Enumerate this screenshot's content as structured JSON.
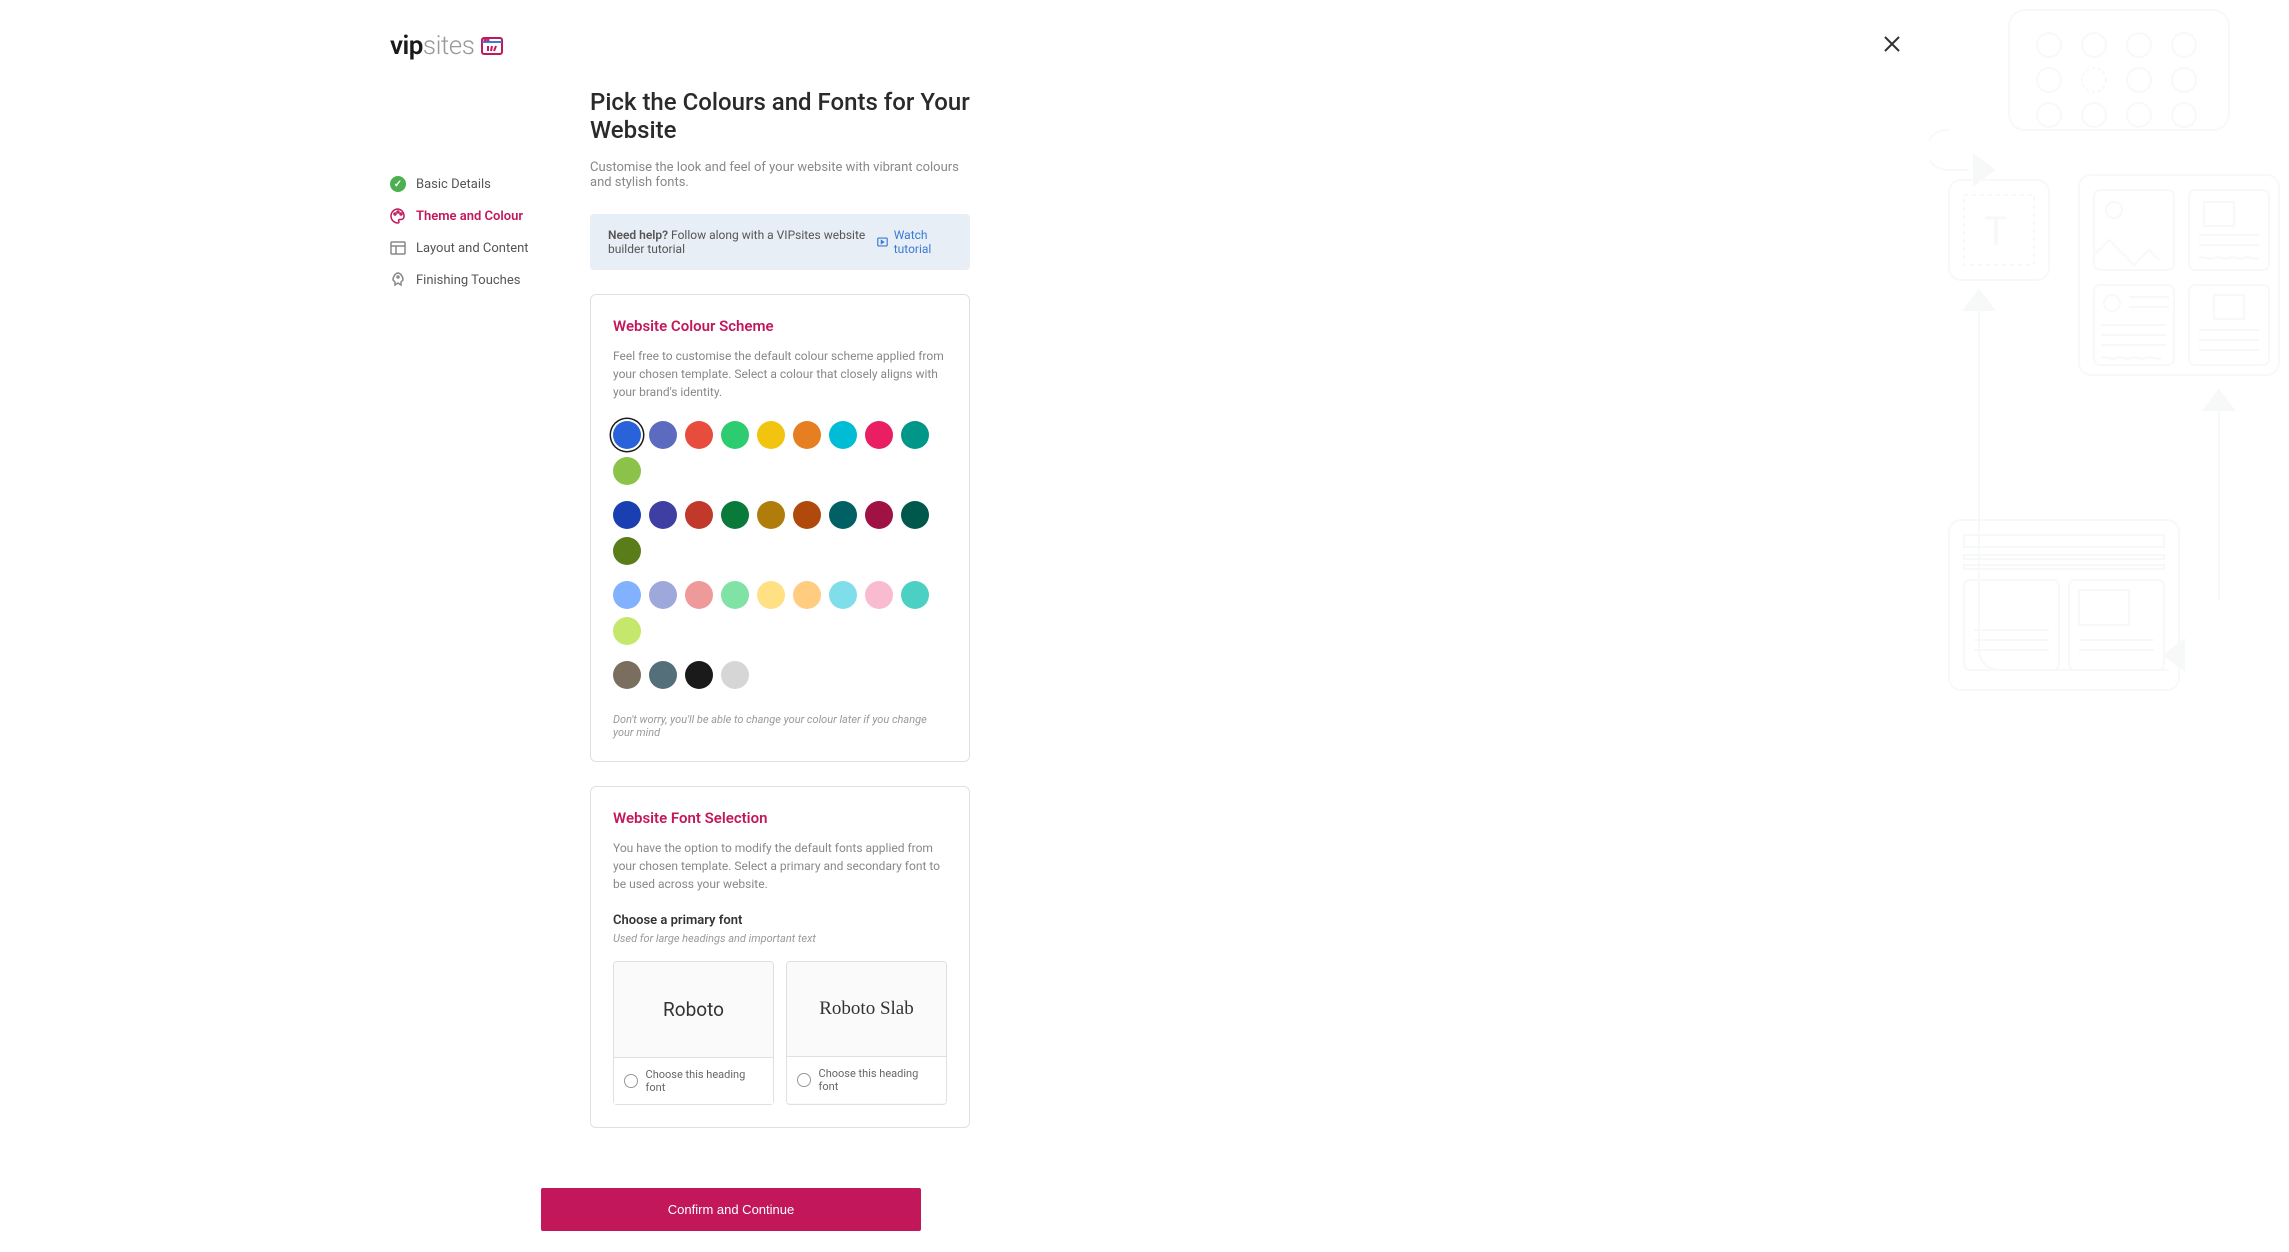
{
  "logo": {
    "text_bold": "vip",
    "text_light": "sites"
  },
  "sidebar": {
    "items": [
      {
        "label": "Basic Details",
        "status": "completed"
      },
      {
        "label": "Theme and Colour",
        "status": "active"
      },
      {
        "label": "Layout and Content",
        "status": "pending"
      },
      {
        "label": "Finishing Touches",
        "status": "pending"
      }
    ]
  },
  "page": {
    "title": "Pick the Colours and Fonts for Your Website",
    "subtitle": "Customise the look and feel of your website with vibrant colours and stylish fonts."
  },
  "banner": {
    "help_label": "Need help?",
    "help_text": " Follow along with a VIPsites website builder tutorial",
    "watch_link": "Watch tutorial"
  },
  "colour_card": {
    "title": "Website Colour Scheme",
    "desc": "Feel free to customise the default colour scheme applied from your chosen template. Select a colour that closely aligns with your brand's identity.",
    "note": "Don't worry, you'll be able to change your colour later if you change your mind",
    "colours_row1": [
      "#2962d9",
      "#5c6bc0",
      "#e74c3c",
      "#2ecc71",
      "#f1c40f",
      "#e67e22",
      "#00bcd4",
      "#e91e63",
      "#009688",
      "#8bc34a"
    ],
    "colours_row2": [
      "#1a3fb0",
      "#3f3fa3",
      "#c0392b",
      "#0a7a3a",
      "#b07d0c",
      "#b04a0c",
      "#006064",
      "#a01244",
      "#00574b",
      "#5a7d1a"
    ],
    "colours_row3": [
      "#82b1ff",
      "#9fa8da",
      "#ef9a9a",
      "#80e2a4",
      "#ffe082",
      "#ffcc80",
      "#80deea",
      "#f8bbd0",
      "#4dd0c4",
      "#c5e86c"
    ],
    "colours_row4": [
      "#7a6e5e",
      "#546e7a",
      "#1a1a1a",
      "#d6d6d6"
    ],
    "selected_colour": "#2962d9"
  },
  "font_card": {
    "title": "Website Font Selection",
    "desc": "You have the option to modify the default fonts applied from your chosen template. Select a primary and secondary font to be used across your website.",
    "primary_heading": "Choose a primary font",
    "primary_subtext": "Used for large headings and important text",
    "option1": "Roboto",
    "option2": "Roboto Slab",
    "choose_label": "Choose this heading font"
  },
  "footer": {
    "confirm": "Confirm and Continue"
  }
}
